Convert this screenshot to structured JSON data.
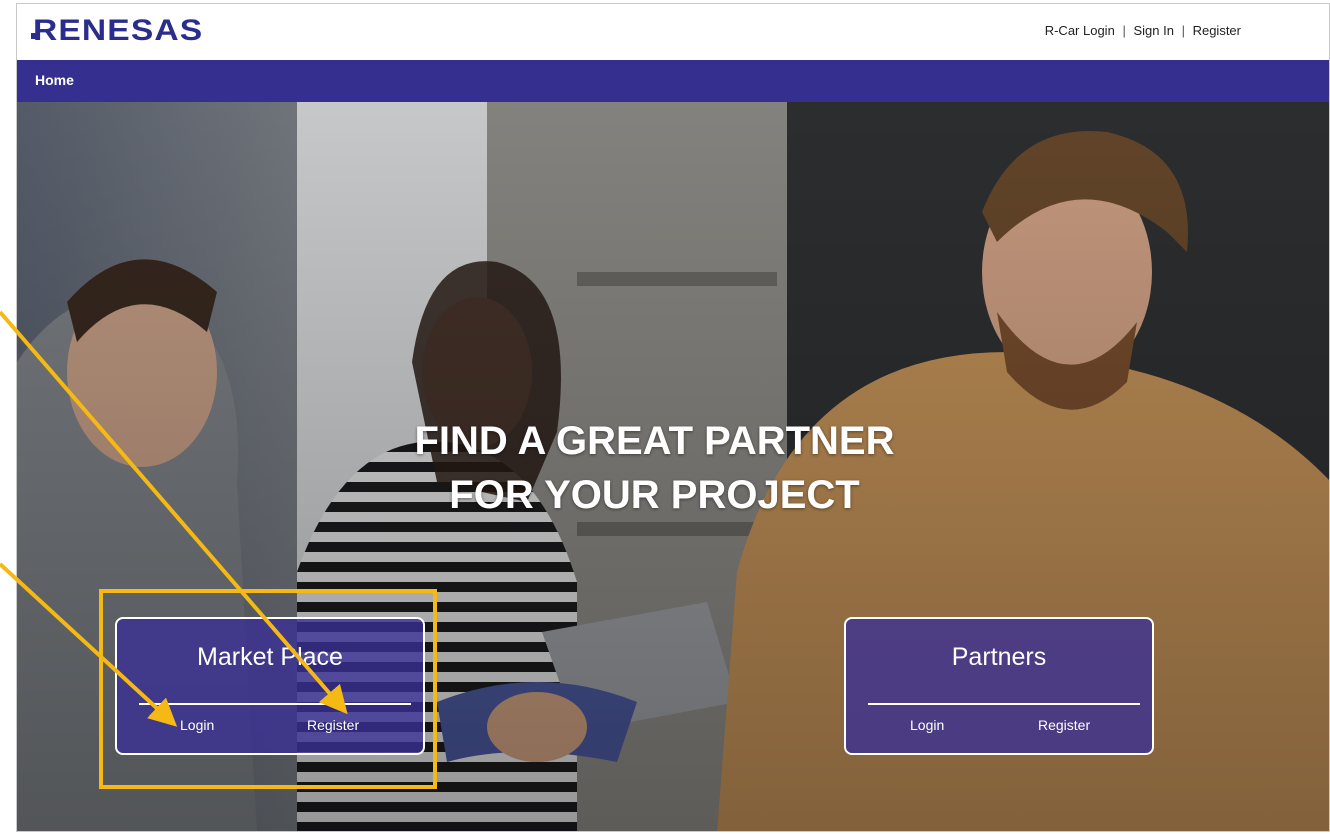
{
  "header": {
    "logo_text": "RENESAS",
    "links": [
      "R-Car Login",
      "Sign In",
      "Register"
    ],
    "separator": "|"
  },
  "nav": {
    "items": [
      "Home"
    ]
  },
  "hero": {
    "headline_line1": "FIND A GREAT PARTNER",
    "headline_line2": "FOR YOUR PROJECT",
    "cards": [
      {
        "title": "Market Place",
        "login": "Login",
        "register": "Register"
      },
      {
        "title": "Partners",
        "login": "Login",
        "register": "Register"
      }
    ]
  },
  "colors": {
    "brand": "#2a2d8c",
    "nav_bar": "#35308f",
    "card_fill": "#3a3096",
    "annotation": "#f5b915"
  }
}
